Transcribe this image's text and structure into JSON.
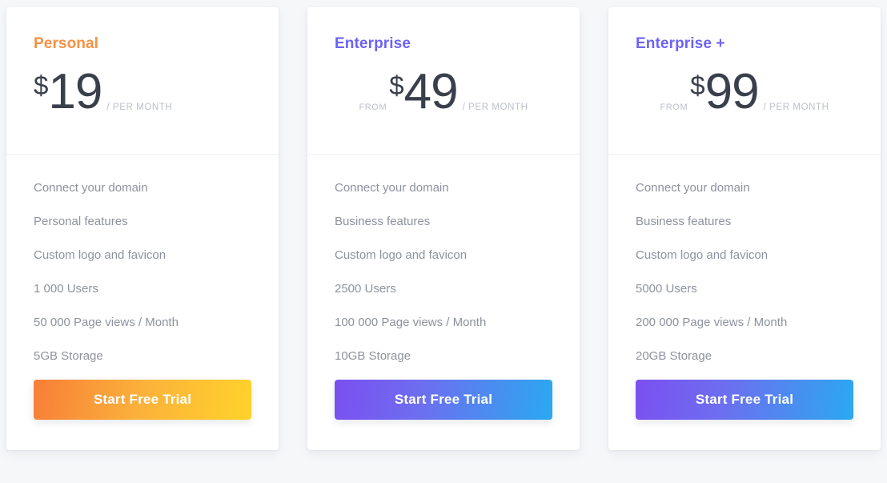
{
  "page": {
    "background_color": "#f6f7f9",
    "card_background": "#ffffff"
  },
  "colors": {
    "accent_orange": "#f79042",
    "accent_violet": "#6c63f5",
    "price_text": "#3a3f4c",
    "muted_text": "#bcc0c9",
    "feature_text": "#8d929e",
    "divider": "#eef0f3",
    "warm_gradient_start": "#f77e37",
    "warm_gradient_end": "#ffd32a",
    "cool_gradient_start": "#7b4ff0",
    "cool_gradient_end": "#2aa9f0"
  },
  "plans": [
    {
      "name": "Personal",
      "from_label": "",
      "currency": "$",
      "amount": "19",
      "period": "/ PER MONTH",
      "features": [
        "Connect your domain",
        "Personal features",
        "Custom logo and favicon",
        "1 000 Users",
        "50 000 Page views / Month",
        "5GB Storage"
      ],
      "cta_label": "Start Free Trial"
    },
    {
      "name": "Enterprise",
      "from_label": "FROM",
      "currency": "$",
      "amount": "49",
      "period": "/ PER MONTH",
      "features": [
        "Connect your domain",
        "Business features",
        "Custom logo and favicon",
        "2500 Users",
        "100 000 Page views / Month",
        "10GB Storage"
      ],
      "cta_label": "Start Free Trial"
    },
    {
      "name": "Enterprise +",
      "from_label": "FROM",
      "currency": "$",
      "amount": "99",
      "period": "/ PER MONTH",
      "features": [
        "Connect your domain",
        "Business features",
        "Custom logo and favicon",
        "5000 Users",
        "200 000 Page views / Month",
        "20GB Storage"
      ],
      "cta_label": "Start Free Trial"
    }
  ]
}
